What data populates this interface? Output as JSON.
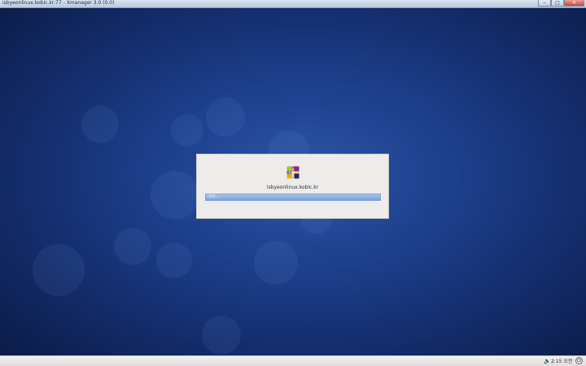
{
  "window": {
    "title": "isbyeonlinux.kobic.kr:77 - Xmanager 3.0 (0.0)",
    "minimize_glyph": "–",
    "maximize_glyph": "□",
    "close_glyph": "✕"
  },
  "login_dialog": {
    "hostname": "isbyeonlinux.kobic.kr",
    "username_field_text": "기타..."
  },
  "panel": {
    "volume_icon": "volume-icon",
    "volume_glyph": "🔈",
    "clock": "2:15 오전",
    "power_glyph": "⏻"
  },
  "colors": {
    "desktop_background": "#1d3f8c",
    "dialog_background": "#eeeceb",
    "input_highlight": "#7aa2da"
  }
}
